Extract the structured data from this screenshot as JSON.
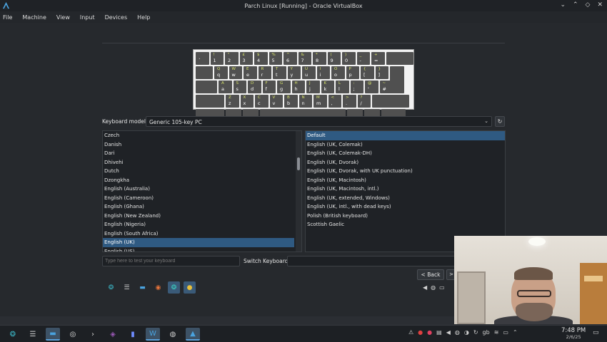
{
  "window": {
    "title": "Parch Linux [Running] - Oracle VirtualBox",
    "controls": [
      "⌄",
      "⌃",
      "◇",
      "✕"
    ]
  },
  "menubar": [
    "File",
    "Machine",
    "View",
    "Input",
    "Devices",
    "Help"
  ],
  "keyboard_preview": {
    "rows": [
      [
        {
          "lo": "`",
          "hi": ""
        },
        {
          "lo": "1",
          "hi": "!"
        },
        {
          "lo": "2",
          "hi": "\""
        },
        {
          "lo": "3",
          "hi": "£"
        },
        {
          "lo": "4",
          "hi": "$"
        },
        {
          "lo": "5",
          "hi": "%"
        },
        {
          "lo": "6",
          "hi": "^"
        },
        {
          "lo": "7",
          "hi": "&"
        },
        {
          "lo": "8",
          "hi": "*"
        },
        {
          "lo": "9",
          "hi": "("
        },
        {
          "lo": "0",
          "hi": ")"
        },
        {
          "lo": "-",
          "hi": "_"
        },
        {
          "lo": "=",
          "hi": "+"
        }
      ],
      [
        {
          "lo": "q",
          "hi": "Q"
        },
        {
          "lo": "w",
          "hi": "W"
        },
        {
          "lo": "e",
          "hi": "E"
        },
        {
          "lo": "r",
          "hi": "R"
        },
        {
          "lo": "t",
          "hi": "T"
        },
        {
          "lo": "y",
          "hi": "Y"
        },
        {
          "lo": "u",
          "hi": "U"
        },
        {
          "lo": "i",
          "hi": "I"
        },
        {
          "lo": "o",
          "hi": "O"
        },
        {
          "lo": "p",
          "hi": "P"
        },
        {
          "lo": "[",
          "hi": "{"
        },
        {
          "lo": "]",
          "hi": "}"
        }
      ],
      [
        {
          "lo": "a",
          "hi": "A"
        },
        {
          "lo": "s",
          "hi": "S"
        },
        {
          "lo": "d",
          "hi": "D"
        },
        {
          "lo": "f",
          "hi": "F"
        },
        {
          "lo": "g",
          "hi": "G"
        },
        {
          "lo": "h",
          "hi": "H"
        },
        {
          "lo": "j",
          "hi": "J"
        },
        {
          "lo": "k",
          "hi": "K"
        },
        {
          "lo": "l",
          "hi": "L"
        },
        {
          "lo": ";",
          "hi": ":"
        },
        {
          "lo": "'",
          "hi": "@"
        },
        {
          "lo": "#",
          "hi": "~"
        }
      ],
      [
        {
          "lo": "z",
          "hi": "Z"
        },
        {
          "lo": "x",
          "hi": "X"
        },
        {
          "lo": "c",
          "hi": "C"
        },
        {
          "lo": "v",
          "hi": "V"
        },
        {
          "lo": "b",
          "hi": "B"
        },
        {
          "lo": "n",
          "hi": "N"
        },
        {
          "lo": "m",
          "hi": "M"
        },
        {
          "lo": ",",
          "hi": "<"
        },
        {
          "lo": ".",
          "hi": ">"
        },
        {
          "lo": "/",
          "hi": "?"
        }
      ]
    ]
  },
  "keyboard_model": {
    "label": "Keyboard model:",
    "value": "Generic 105-key PC"
  },
  "layouts": [
    "Czech",
    "Danish",
    "Dari",
    "Dhivehi",
    "Dutch",
    "Dzongkha",
    "English (Australia)",
    "English (Cameroon)",
    "English (Ghana)",
    "English (New Zealand)",
    "English (Nigeria)",
    "English (South Africa)",
    "English (UK)",
    "English (US)"
  ],
  "layouts_selected": 12,
  "variants": [
    "Default",
    "English (UK, Colemak)",
    "English (UK, Colemak-DH)",
    "English (UK, Dvorak)",
    "English (UK, Dvorak, with UK punctuation)",
    "English (UK, Macintosh)",
    "English (UK, Macintosh, intl.)",
    "English (UK, extended, Windows)",
    "English (UK, intl., with dead keys)",
    "Polish (British keyboard)",
    "Scottish Gaelic"
  ],
  "variants_selected": 0,
  "test": {
    "placeholder": "Type here to test your keyboard",
    "switch_label": "Switch Keyboard:"
  },
  "nav": {
    "back": "< Back",
    "next": ">"
  },
  "clock": {
    "time": "7:48 PM",
    "date": "2/6/25"
  },
  "tray_text": "gb"
}
